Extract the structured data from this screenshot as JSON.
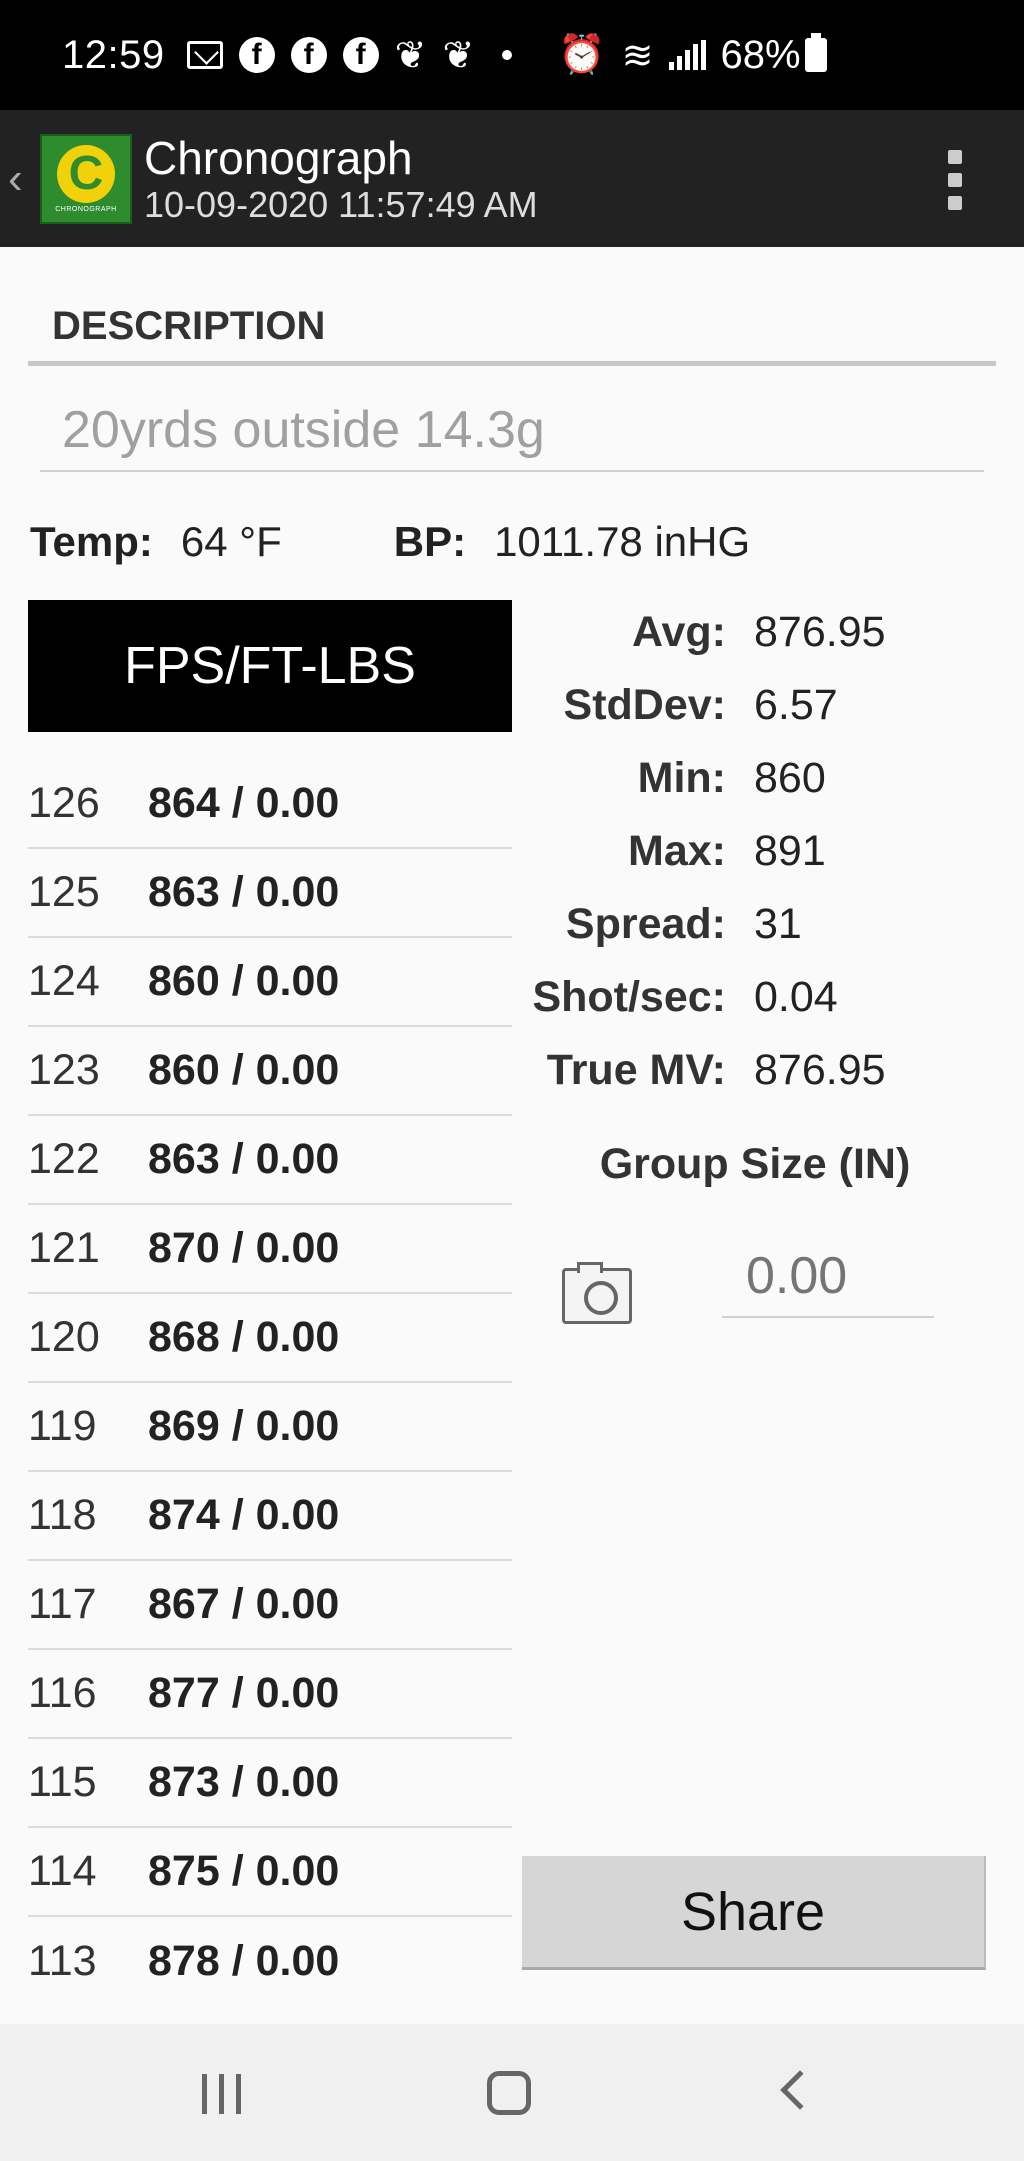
{
  "status_bar": {
    "time": "12:59",
    "battery": "68%",
    "icons": [
      "mail-icon",
      "facebook-icon",
      "facebook-icon",
      "facebook-icon",
      "feather-icon",
      "feather-icon",
      "dot-icon",
      "alarm-icon",
      "wifi-icon",
      "signal-icon",
      "battery-icon"
    ]
  },
  "app_bar": {
    "title": "Chronograph",
    "subtitle": "10-09-2020 11:57:49 AM",
    "logo_letter": "C",
    "logo_text": "CHRONOGRAPH"
  },
  "description": {
    "header": "DESCRIPTION",
    "value": "20yrds outside 14.3g"
  },
  "weather": {
    "temp_label": "Temp:",
    "temp_value": "64 °F",
    "bp_label": "BP:",
    "bp_value": "1011.78 inHG"
  },
  "shots": {
    "header": "FPS/FT-LBS",
    "rows": [
      {
        "num": "126",
        "value": "864 / 0.00"
      },
      {
        "num": "125",
        "value": "863 / 0.00"
      },
      {
        "num": "124",
        "value": "860 / 0.00"
      },
      {
        "num": "123",
        "value": "860 / 0.00"
      },
      {
        "num": "122",
        "value": "863 / 0.00"
      },
      {
        "num": "121",
        "value": "870 / 0.00"
      },
      {
        "num": "120",
        "value": "868 / 0.00"
      },
      {
        "num": "119",
        "value": "869 / 0.00"
      },
      {
        "num": "118",
        "value": "874 / 0.00"
      },
      {
        "num": "117",
        "value": "867 / 0.00"
      },
      {
        "num": "116",
        "value": "877 / 0.00"
      },
      {
        "num": "115",
        "value": "873 / 0.00"
      },
      {
        "num": "114",
        "value": "875 / 0.00"
      },
      {
        "num": "113",
        "value": "878 / 0.00"
      }
    ]
  },
  "stats": [
    {
      "label": "Avg:",
      "value": "876.95"
    },
    {
      "label": "StdDev:",
      "value": "6.57"
    },
    {
      "label": "Min:",
      "value": "860"
    },
    {
      "label": "Max:",
      "value": "891"
    },
    {
      "label": "Spread:",
      "value": "31"
    },
    {
      "label": "Shot/sec:",
      "value": "0.04"
    },
    {
      "label": "True MV:",
      "value": "876.95"
    }
  ],
  "group": {
    "title": "Group Size (IN)",
    "placeholder": "0.00"
  },
  "share_label": "Share",
  "colors": {
    "status_bar": "#000000",
    "app_bar": "#222222",
    "logo_green": "#2e8b2e",
    "logo_yellow": "#f1d20a",
    "header_black": "#000000",
    "share_button": "#d6d6d6"
  }
}
